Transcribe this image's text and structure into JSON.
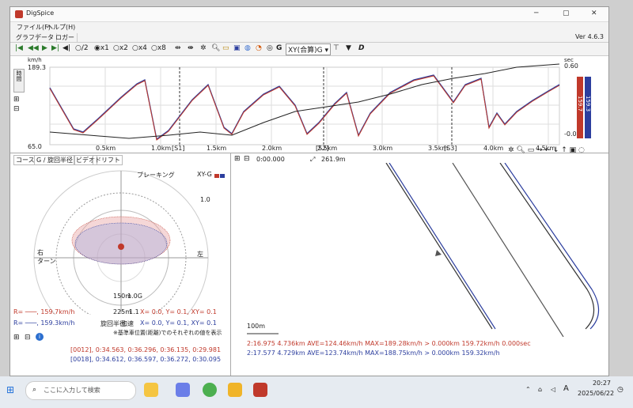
{
  "window": {
    "title": "DigSpice",
    "minimize": "─",
    "maximize": "▢",
    "close": "✕"
  },
  "menu": [
    "ファイル(F)",
    "ヘルプ(H)"
  ],
  "top_tabs": [
    "グラフ",
    "データ",
    "ロガー"
  ],
  "version": "Ver 4.6.3",
  "toolbar": {
    "speed_options": [
      "/2",
      "x1",
      "x2",
      "x4",
      "x8"
    ],
    "selected_speed": "x1",
    "xy_mode": "XY(合算)G",
    "mode_d": "D"
  },
  "graph": {
    "y_unit": "km/h",
    "y_max": "189.3",
    "y_min": "65.0",
    "right_unit": "sec",
    "right_max": "0.60",
    "right_min": "-0.03",
    "side_labels": [
      "時間"
    ],
    "legend_red": "159.7",
    "legend_blue": "159.3",
    "x_ticks": [
      "0.5km",
      "1.0km",
      "1.5km",
      "2.0km",
      "2.5km",
      "3.0km",
      "3.5km",
      "4.0km",
      "4.5km"
    ],
    "sectors": [
      "[S1]",
      "[S2]",
      "[S3]"
    ]
  },
  "lower_left": {
    "tabs": [
      "コース",
      "G / 旋回半径",
      "ビデオ",
      "ドリフト"
    ],
    "braking": "ブレーキング",
    "xy_label": "XY-G",
    "scale_top": "1.0",
    "left_label": "右\nターン",
    "right_label": "左",
    "accel": "加速",
    "radius_labels": [
      "150m",
      "225m"
    ],
    "g_labels": [
      "1.0G",
      "1.1"
    ],
    "rows": [
      {
        "label": "R= ───, 159.7km/h",
        "xyz": "X=  0.0,  Y=  0.1,  XY= 0.1",
        "color": "red"
      },
      {
        "label": "R= ───, 159.3km/h",
        "xyz": "X=  0.0,  Y=  0.1,  XY= 0.1",
        "color": "blue"
      }
    ],
    "radius_text": "旋回半径",
    "note": "※基準車位置(距離)でのそれぞれの値を表示",
    "laps": [
      {
        "text": "[0012], 0:34.563, 0:36.296, 0:36.135, 0:29.981",
        "color": "red"
      },
      {
        "text": "[0018], 0:34.612, 0:36.597, 0:36.272, 0:30.095",
        "color": "blue"
      }
    ]
  },
  "lower_right": {
    "time": "0:00.000",
    "distance": "261.9m",
    "scale": "100m",
    "lap_summary": [
      {
        "text": "2:16.975 4.736km AVE=124.46km/h MAX=189.28km/h > 0.000km 159.72km/h 0.000sec",
        "color": "red"
      },
      {
        "text": "2:17.577 4.729km AVE=123.74km/h MAX=188.75km/h > 0.000km 159.32km/h",
        "color": "blue"
      }
    ]
  },
  "taskbar": {
    "search_placeholder": "ここに入力して検索",
    "ime": "A",
    "time": "20:27",
    "date": "2025/06/22"
  },
  "colors": {
    "red": "#c0392b",
    "blue": "#2c3e9e",
    "black": "#222222"
  }
}
